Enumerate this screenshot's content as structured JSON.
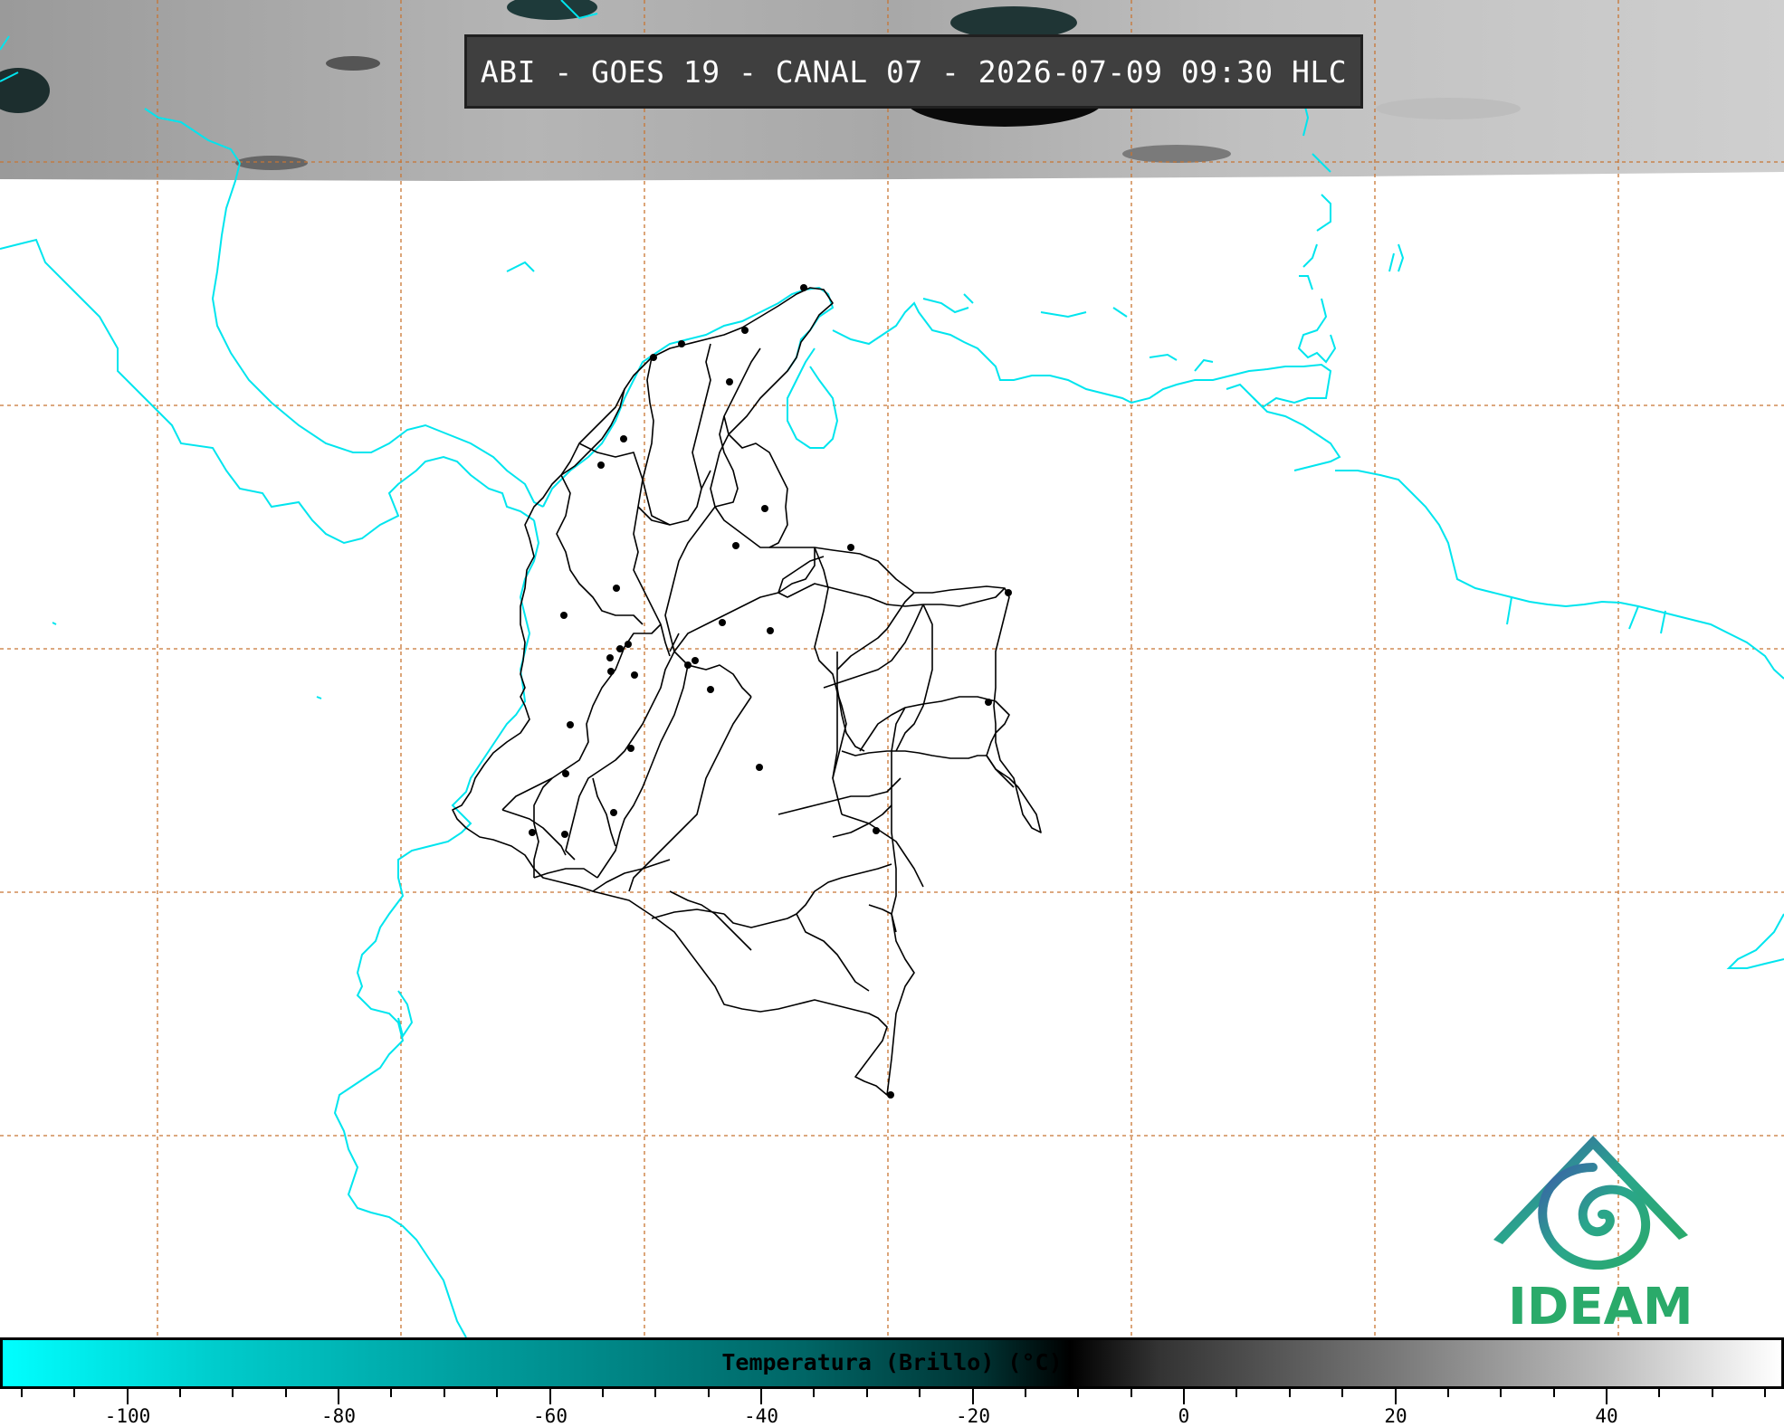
{
  "title": "ABI - GOES 19 - CANAL 07 - 2026-07-09 09:30 HLC",
  "colorbar": {
    "label": "Temperatura (Brillo) (°C)",
    "ticks": [
      "-100",
      "-80",
      "-60",
      "-40",
      "-20",
      "0",
      "20",
      "40"
    ],
    "colors": [
      "#00ffff",
      "#009999",
      "#003333",
      "#000000",
      "#777777",
      "#ffffff"
    ]
  },
  "logo": {
    "text": "IDEAM",
    "colors": [
      "#3a5fa8",
      "#2aa58c",
      "#2aaa6a"
    ]
  },
  "map": {
    "coastline_color": "#00e5ee",
    "border_color": "#000000",
    "grid_color": "#c87533",
    "satellite_band": "cloud imagery (grayscale) across top of map"
  }
}
